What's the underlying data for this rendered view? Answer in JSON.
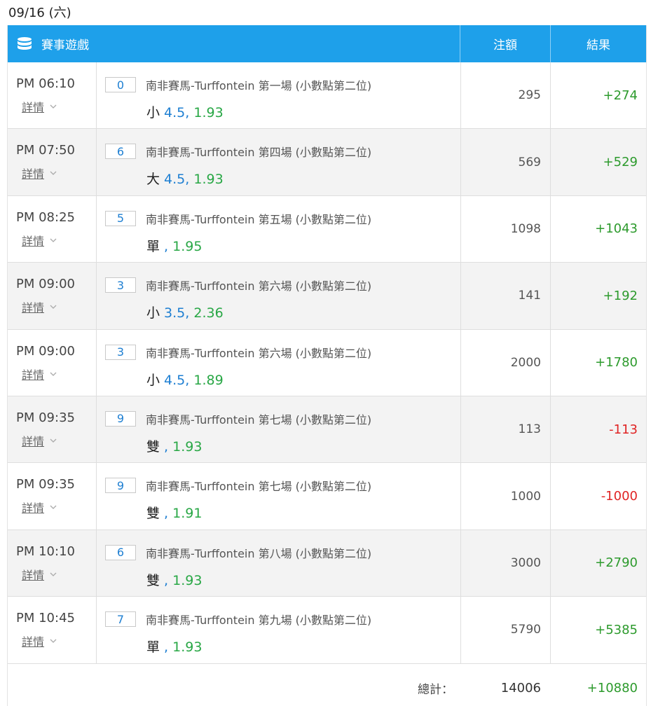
{
  "date_label": "09/16 (六)",
  "header": {
    "game_label": "賽事遊戲",
    "amount_label": "注額",
    "result_label": "結果"
  },
  "detail_label": "詳情",
  "rows": [
    {
      "time": "PM 06:10",
      "num": "0",
      "event": "南非賽馬-Turffontein 第一場 (小數點第二位)",
      "pick_type": "小",
      "pick_line": " 4.5,",
      "odds": " 1.93",
      "amount": "295",
      "result": "+274",
      "status": "pos"
    },
    {
      "time": "PM 07:50",
      "num": "6",
      "event": "南非賽馬-Turffontein 第四場 (小數點第二位)",
      "pick_type": "大",
      "pick_line": " 4.5,",
      "odds": " 1.93",
      "amount": "569",
      "result": "+529",
      "status": "pos"
    },
    {
      "time": "PM 08:25",
      "num": "5",
      "event": "南非賽馬-Turffontein 第五場 (小數點第二位)",
      "pick_type": "單",
      "pick_line": " ,",
      "odds": " 1.95",
      "amount": "1098",
      "result": "+1043",
      "status": "pos"
    },
    {
      "time": "PM 09:00",
      "num": "3",
      "event": "南非賽馬-Turffontein 第六場 (小數點第二位)",
      "pick_type": "小",
      "pick_line": " 3.5,",
      "odds": " 2.36",
      "amount": "141",
      "result": "+192",
      "status": "pos"
    },
    {
      "time": "PM 09:00",
      "num": "3",
      "event": "南非賽馬-Turffontein 第六場 (小數點第二位)",
      "pick_type": "小",
      "pick_line": " 4.5,",
      "odds": " 1.89",
      "amount": "2000",
      "result": "+1780",
      "status": "pos"
    },
    {
      "time": "PM 09:35",
      "num": "9",
      "event": "南非賽馬-Turffontein 第七場 (小數點第二位)",
      "pick_type": "雙",
      "pick_line": " ,",
      "odds": " 1.93",
      "amount": "113",
      "result": "-113",
      "status": "neg"
    },
    {
      "time": "PM 09:35",
      "num": "9",
      "event": "南非賽馬-Turffontein 第七場 (小數點第二位)",
      "pick_type": "雙",
      "pick_line": " ,",
      "odds": " 1.91",
      "amount": "1000",
      "result": "-1000",
      "status": "neg"
    },
    {
      "time": "PM 10:10",
      "num": "6",
      "event": "南非賽馬-Turffontein 第八場 (小數點第二位)",
      "pick_type": "雙",
      "pick_line": " ,",
      "odds": " 1.93",
      "amount": "3000",
      "result": "+2790",
      "status": "pos"
    },
    {
      "time": "PM 10:45",
      "num": "7",
      "event": "南非賽馬-Turffontein 第九場 (小數點第二位)",
      "pick_type": "單",
      "pick_line": " ,",
      "odds": " 1.93",
      "amount": "5790",
      "result": "+5385",
      "status": "pos"
    }
  ],
  "footer": {
    "total_label": "總計：",
    "total_amount": "14006",
    "total_result": "+10880"
  },
  "colors": {
    "header_bg": "#1ea0ea",
    "positive": "#2c9a2c",
    "negative": "#e02424",
    "line_blue": "#1e7fd2",
    "odds_green": "#28a745"
  },
  "icons": {
    "header": "database-icon",
    "detail": "chevron-down-icon"
  }
}
